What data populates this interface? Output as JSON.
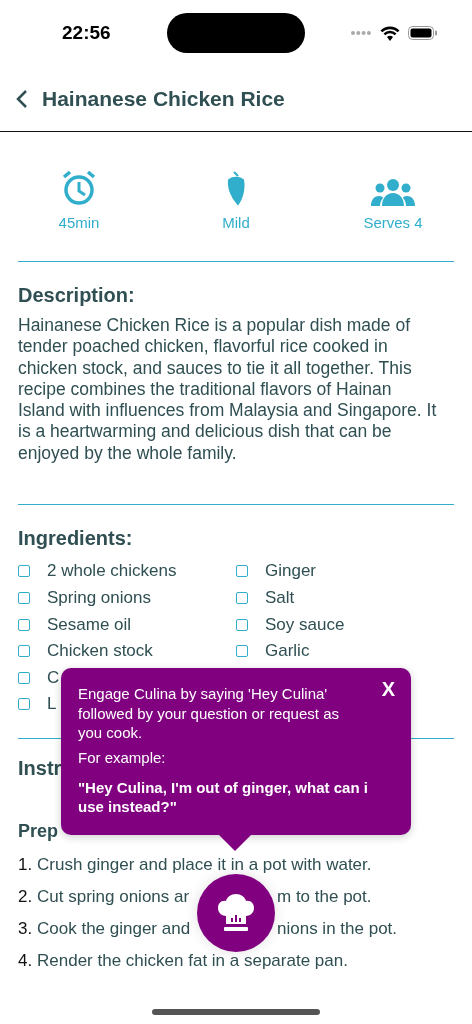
{
  "status_bar": {
    "time": "22:56"
  },
  "header": {
    "title": "Hainanese Chicken Rice"
  },
  "facts": [
    {
      "kind": "time",
      "label": "45min"
    },
    {
      "kind": "spice",
      "label": "Mild"
    },
    {
      "kind": "serves",
      "label": "Serves 4"
    }
  ],
  "description": {
    "heading": "Description:",
    "text": "Hainanese Chicken Rice is a popular dish made of tender poached chicken, flavorful rice cooked in chicken stock, and sauces to tie it all together. This recipe combines the traditional flavors of Hainan Island with influences from Malaysia and Singapore. It is a heartwarming and delicious dish that can be enjoyed by the whole family."
  },
  "ingredients": {
    "heading": "Ingredients:",
    "columns": [
      [
        {
          "name": "2 whole chickens",
          "checked": false
        },
        {
          "name": "Spring onions",
          "checked": false
        },
        {
          "name": "Sesame oil",
          "checked": false
        },
        {
          "name": "Chicken stock",
          "checked": false
        },
        {
          "name": "C",
          "checked": false
        },
        {
          "name": "L",
          "checked": false
        }
      ],
      [
        {
          "name": "Ginger",
          "checked": false
        },
        {
          "name": "Salt",
          "checked": false
        },
        {
          "name": "Soy sauce",
          "checked": false
        },
        {
          "name": "Garlic",
          "checked": false
        }
      ]
    ]
  },
  "instructions": {
    "heading": "Instr",
    "subheading": "Prep",
    "steps": [
      {
        "number": "1.",
        "text": "Crush ginger and place it in a pot with water."
      },
      {
        "number": "2.",
        "text": "Cut spring onions ar",
        "text_after": "m to the pot."
      },
      {
        "number": "3.",
        "text": "Cook the ginger and",
        "text_after": "nions in the pot."
      },
      {
        "number": "4.",
        "text": "Render the chicken fat in a separate pan."
      }
    ]
  },
  "popover": {
    "close": "X",
    "message": "Engage Culina by saying 'Hey Culina' followed by your question or request as you cook.",
    "example_label": "For example:",
    "example": "\"Hey Culina, I'm out of ginger, what can i use instead?\""
  }
}
